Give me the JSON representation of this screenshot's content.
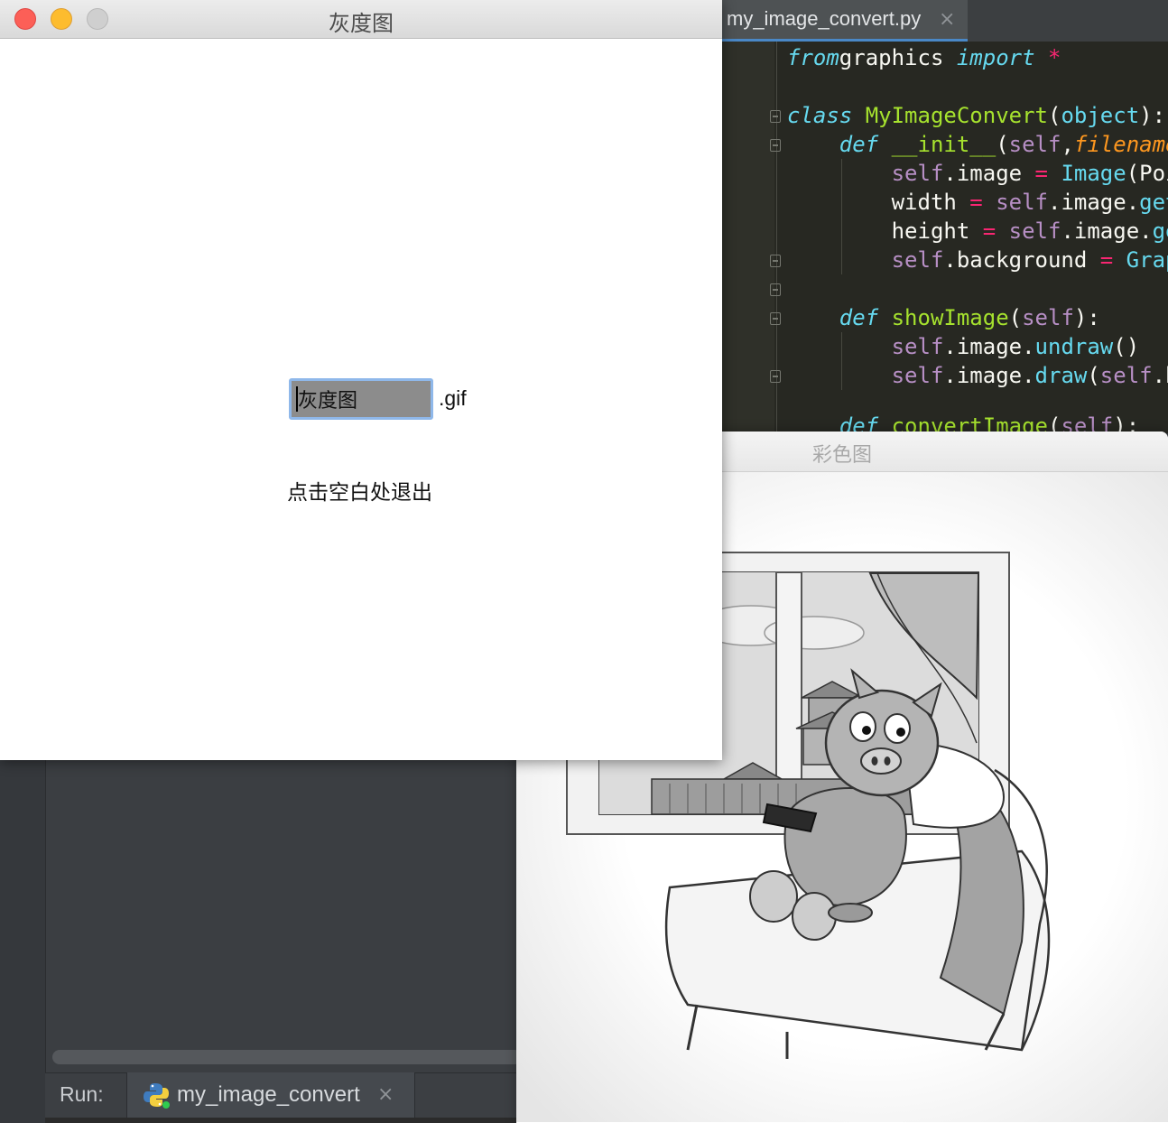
{
  "ide": {
    "editor_tab": {
      "label": "my_image_convert.py",
      "close_glyph": "×"
    },
    "code_lines": [
      [
        [
          "kw-i",
          "from"
        ],
        [
          "",
          "graphics "
        ],
        [
          "kw-i",
          "import"
        ],
        [
          "",
          ""
        ],
        [
          "op",
          " *"
        ]
      ],
      [],
      [
        [
          "kw-i",
          "class"
        ],
        [
          "",
          ""
        ],
        [
          "cls",
          " MyImageConvert"
        ],
        [
          "",
          "("
        ],
        [
          "bi",
          "object"
        ],
        [
          "",
          "):"
        ]
      ],
      [
        [
          "",
          ""
        ],
        [
          "kw-i",
          "    def"
        ],
        [
          "fn",
          " __init__"
        ],
        [
          "",
          "("
        ],
        [
          "slf",
          "self"
        ],
        [
          "",
          ","
        ],
        [
          "param",
          "filename"
        ]
      ],
      [
        [
          "slf",
          "        self"
        ],
        [
          "",
          ".image "
        ],
        [
          "op",
          "="
        ],
        [
          "bi",
          " Image"
        ],
        [
          "",
          "(Poi"
        ]
      ],
      [
        [
          "",
          "        width "
        ],
        [
          "op",
          "="
        ],
        [
          "slf",
          " self"
        ],
        [
          "",
          ".image."
        ],
        [
          "bi",
          "getW"
        ]
      ],
      [
        [
          "",
          "        height "
        ],
        [
          "op",
          "="
        ],
        [
          "slf",
          " self"
        ],
        [
          "",
          ".image."
        ],
        [
          "bi",
          "get"
        ]
      ],
      [
        [
          "slf",
          "        self"
        ],
        [
          "",
          ".background "
        ],
        [
          "op",
          "="
        ],
        [
          "bi",
          " Graph"
        ]
      ],
      [],
      [
        [
          "kw-i",
          "    def"
        ],
        [
          "fn",
          " showImage"
        ],
        [
          "",
          "("
        ],
        [
          "slf",
          "self"
        ],
        [
          "",
          "):"
        ]
      ],
      [
        [
          "slf",
          "        self"
        ],
        [
          "",
          ".image."
        ],
        [
          "bi",
          "undraw"
        ],
        [
          "",
          "()"
        ]
      ],
      [
        [
          "slf",
          "        self"
        ],
        [
          "",
          ".image."
        ],
        [
          "bi",
          "draw"
        ],
        [
          "",
          "("
        ],
        [
          "slf",
          "self"
        ],
        [
          "",
          ".b"
        ]
      ],
      [],
      [
        [
          "kw-i",
          "    def"
        ],
        [
          "fn",
          " convertImage"
        ],
        [
          "",
          "("
        ],
        [
          "slf",
          "self"
        ],
        [
          "",
          "):"
        ]
      ]
    ],
    "run": {
      "label": "Run:",
      "tab_label": "my_image_convert",
      "close_glyph": "×",
      "tab_icon": "python-icon"
    }
  },
  "gray_window": {
    "title": "灰度图",
    "entry_value": "灰度图",
    "suffix": ".gif",
    "hint": "点击空白处退出",
    "entry_fill": "#8c8c8c",
    "focus_ring": "#8fb8ea"
  },
  "color_window": {
    "title": "彩色图",
    "image_icon": "pig-cartoon-image"
  },
  "colors": {
    "close": "#fc5f57",
    "minimize": "#fdbc2e",
    "maximize": "#cfcfcf",
    "editor_bg": "#272822",
    "keyword": "#66d9ef",
    "function": "#a6e22e",
    "operator": "#f92672"
  }
}
